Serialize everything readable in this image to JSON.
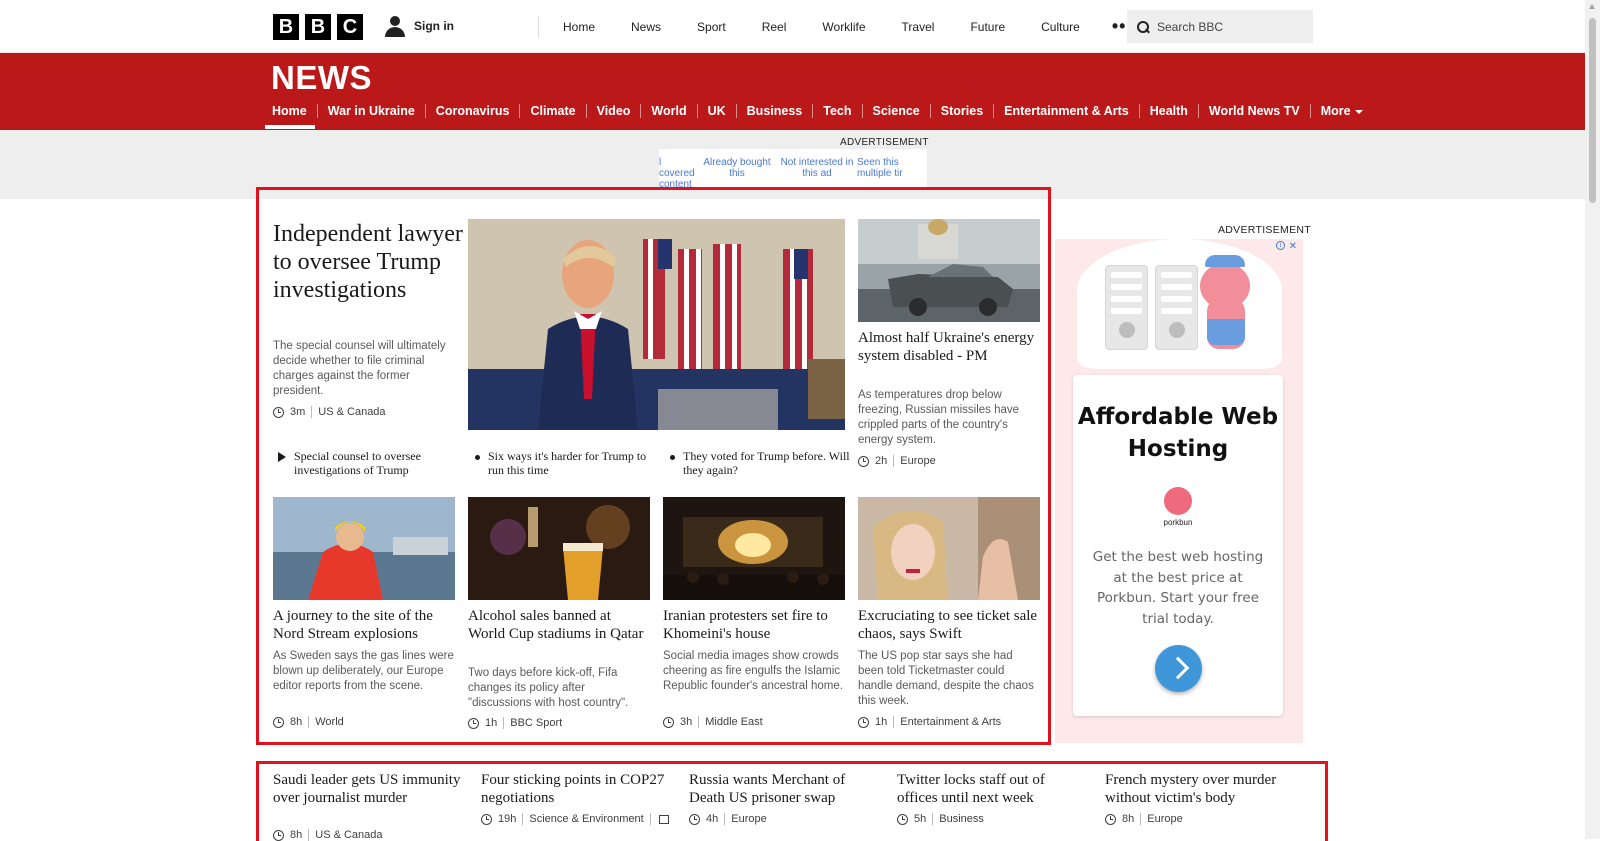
{
  "header": {
    "logo_letters": [
      "B",
      "B",
      "C"
    ],
    "signin_label": "Sign in",
    "nav": [
      "Home",
      "News",
      "Sport",
      "Reel",
      "Worklife",
      "Travel",
      "Future",
      "Culture"
    ],
    "more_dots": "•••",
    "search_placeholder": "Search BBC"
  },
  "news_header": {
    "title": "NEWS",
    "nav": [
      "Home",
      "War in Ukraine",
      "Coronavirus",
      "Climate",
      "Video",
      "World",
      "UK",
      "Business",
      "Tech",
      "Science",
      "Stories",
      "Entertainment & Arts",
      "Health",
      "World News TV"
    ],
    "more_label": "More",
    "active_item": "Home"
  },
  "ad_strip": {
    "label": "ADVERTISEMENT",
    "options": [
      "l covered content",
      "Already bought this",
      "Not interested in this ad",
      "Seen this multiple tir"
    ]
  },
  "lead_story": {
    "title": "Independent lawyer to oversee Trump investigations",
    "summary": "The special counsel will ultimately decide whether to file criminal charges against the former president.",
    "time": "3m",
    "tag": "US & Canada",
    "related": [
      {
        "type": "video",
        "text": "Special counsel to oversee investigations of Trump"
      },
      {
        "type": "bullet",
        "text": "Six ways it's harder for Trump to run this time"
      },
      {
        "type": "bullet",
        "text": "They voted for Trump before. Will they again?"
      }
    ]
  },
  "side_story": {
    "title": "Almost half Ukraine's energy system disabled - PM",
    "summary": "As temperatures drop below freezing, Russian missiles have crippled parts of the country's energy system.",
    "time": "2h",
    "tag": "Europe"
  },
  "grid_stories": [
    {
      "title": "A journey to the site of the Nord Stream explosions",
      "summary": "As Sweden says the gas lines were blown up deliberately, our Europe editor reports from the scene.",
      "time": "8h",
      "tag": "World"
    },
    {
      "title": "Alcohol sales banned at World Cup stadiums in Qatar",
      "summary": "Two days before kick-off, Fifa changes its policy after \"discussions with host country\".",
      "time": "1h",
      "tag": "BBC Sport"
    },
    {
      "title": "Iranian protesters set fire to Khomeini's house",
      "summary": "Social media images show crowds cheering as fire engulfs the Islamic Republic founder's ancestral home.",
      "time": "3h",
      "tag": "Middle East"
    },
    {
      "title": "Excruciating to see ticket sale chaos, says Swift",
      "summary": "The US pop star says she had been told Ticketmaster could handle demand, despite the chaos this week.",
      "time": "1h",
      "tag": "Entertainment & Arts"
    }
  ],
  "bottom_stories": [
    {
      "title": "Saudi leader gets US immunity over journalist murder",
      "time": "8h",
      "tag": "US & Canada"
    },
    {
      "title": "Four sticking points in COP27 negotiations",
      "time": "19h",
      "tag": "Science & Environment"
    },
    {
      "title": "Russia wants Merchant of Death US prisoner swap",
      "time": "4h",
      "tag": "Europe"
    },
    {
      "title": "Twitter locks staff out of offices until next week",
      "time": "5h",
      "tag": "Business"
    },
    {
      "title": "French mystery over murder without victim's body",
      "time": "8h",
      "tag": "Europe"
    }
  ],
  "right_ad": {
    "label": "ADVERTISEMENT",
    "title": "Affordable Web Hosting",
    "brand": "porkbun",
    "text": "Get the best web hosting at the best price at Porkbun. Start your free trial today.",
    "info_icon": "i",
    "close_icon": "✕"
  },
  "colors": {
    "news_red": "#bb1919",
    "highlight_red": "#e0121f",
    "ad_pink": "#fde8ea",
    "ad_blue": "#3f97d9"
  }
}
